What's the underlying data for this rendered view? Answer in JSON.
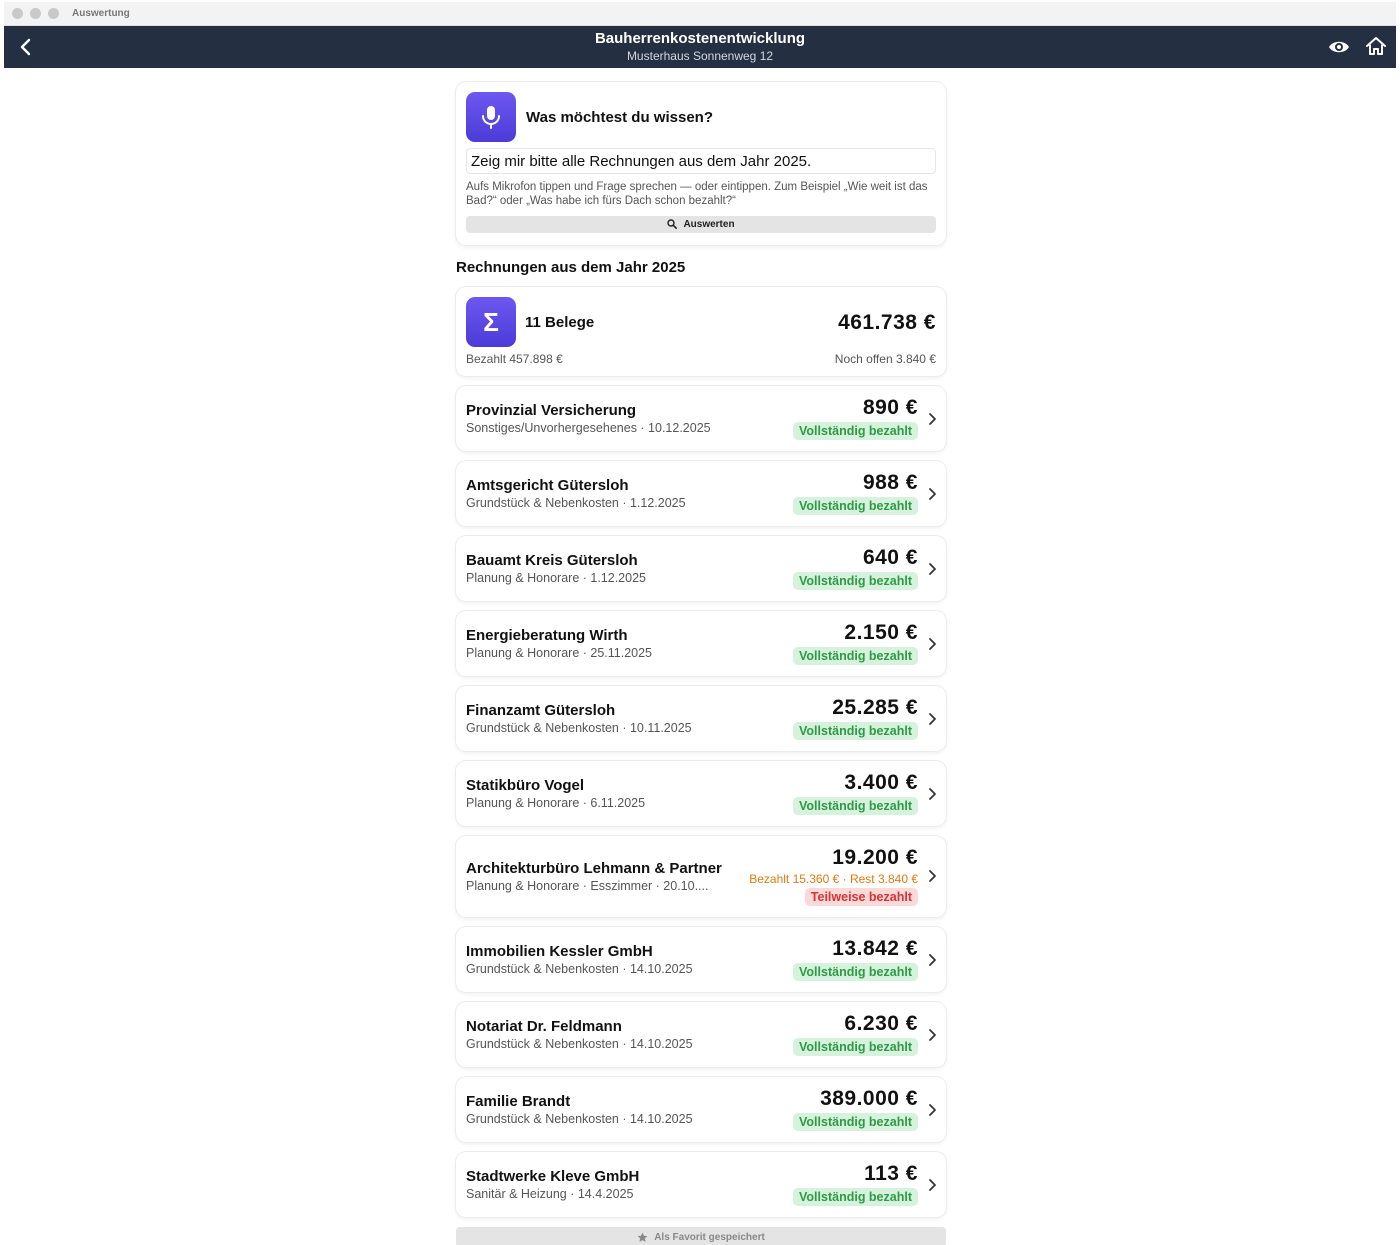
{
  "window": {
    "title": "Auswertung"
  },
  "nav": {
    "title": "Bauherrenkostenentwicklung",
    "subtitle": "Musterhaus Sonnenweg 12"
  },
  "ask": {
    "title": "Was möchtest du wissen?",
    "query": "Zeig mir bitte alle Rechnungen aus dem Jahr 2025.",
    "hint": "Aufs Mikrofon tippen und Frage sprechen — oder eintippen. Zum Beispiel „Wie weit ist das Bad?“ oder „Was habe ich fürs Dach schon bezahlt?“",
    "button": "Auswerten"
  },
  "section_title": "Rechnungen aus dem Jahr 2025",
  "summary": {
    "count_label": "11 Belege",
    "total": "461.738 €",
    "paid": "Bezahlt 457.898 €",
    "open": "Noch offen 3.840 €",
    "icon_glyph": "Σ"
  },
  "invoices": [
    {
      "name": "Provinzial Versicherung",
      "sub": "Sonstiges/Unvorhergesehenes · 10.12.2025",
      "amount": "890 €",
      "status": "Vollständig bezahlt",
      "partial": false
    },
    {
      "name": "Amtsgericht Gütersloh",
      "sub": "Grundstück & Nebenkosten · 1.12.2025",
      "amount": "988 €",
      "status": "Vollständig bezahlt",
      "partial": false
    },
    {
      "name": "Bauamt Kreis Gütersloh",
      "sub": "Planung & Honorare · 1.12.2025",
      "amount": "640 €",
      "status": "Vollständig bezahlt",
      "partial": false
    },
    {
      "name": "Energieberatung Wirth",
      "sub": "Planung & Honorare · 25.11.2025",
      "amount": "2.150 €",
      "status": "Vollständig bezahlt",
      "partial": false
    },
    {
      "name": "Finanzamt Gütersloh",
      "sub": "Grundstück & Nebenkosten · 10.11.2025",
      "amount": "25.285 €",
      "status": "Vollständig bezahlt",
      "partial": false
    },
    {
      "name": "Statikbüro Vogel",
      "sub": "Planung & Honorare · 6.11.2025",
      "amount": "3.400 €",
      "status": "Vollständig bezahlt",
      "partial": false
    },
    {
      "name": "Architekturbüro Lehmann & Partner",
      "sub": "Planung & Honorare · Esszimmer · 20.10....",
      "amount": "19.200 €",
      "rest": "Bezahlt 15.360 € · Rest 3.840 €",
      "status": "Teilweise bezahlt",
      "partial": true
    },
    {
      "name": "Immobilien Kessler GmbH",
      "sub": "Grundstück & Nebenkosten · 14.10.2025",
      "amount": "13.842 €",
      "status": "Vollständig bezahlt",
      "partial": false
    },
    {
      "name": "Notariat Dr. Feldmann",
      "sub": "Grundstück & Nebenkosten · 14.10.2025",
      "amount": "6.230 €",
      "status": "Vollständig bezahlt",
      "partial": false
    },
    {
      "name": "Familie Brandt",
      "sub": "Grundstück & Nebenkosten · 14.10.2025",
      "amount": "389.000 €",
      "status": "Vollständig bezahlt",
      "partial": false
    },
    {
      "name": "Stadtwerke Kleve GmbH",
      "sub": "Sanitär & Heizung · 14.4.2025",
      "amount": "113 €",
      "status": "Vollständig bezahlt",
      "partial": false
    }
  ],
  "favorite": {
    "label": "Als Favorit gespeichert"
  },
  "colors": {
    "nav_bg": "#243042",
    "accent": "#5b46e4",
    "paid_green": "#2e9a45",
    "partial_red": "#d93232",
    "rest_orange": "#e07a10"
  }
}
